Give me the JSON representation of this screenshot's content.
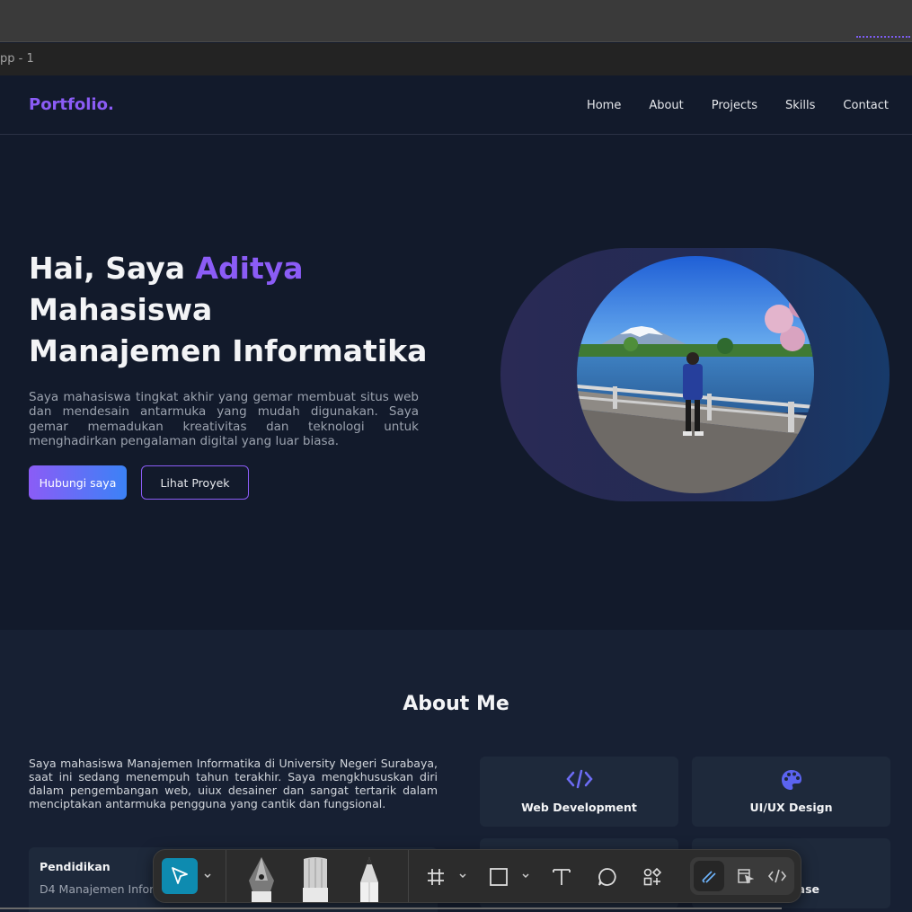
{
  "editor": {
    "frame_label": "pp - 1"
  },
  "nav": {
    "logo": "Portfolio.",
    "links": [
      "Home",
      "About",
      "Projects",
      "Skills",
      "Contact"
    ]
  },
  "hero": {
    "greeting": "Hai, Saya ",
    "name": "Aditya",
    "line2": "Mahasiswa",
    "line3": "Manajemen Informatika",
    "description": "Saya mahasiswa tingkat akhir yang gemar membuat situs web dan mendesain antarmuka yang mudah digunakan. Saya gemar memadukan kreativitas dan teknologi untuk menghadirkan pengalaman digital yang luar biasa.",
    "primary_button": "Hubungi saya",
    "secondary_button": "Lihat Proyek"
  },
  "about": {
    "title": "About Me",
    "description": "Saya mahasiswa Manajemen Informatika di University Negeri Surabaya, saat ini sedang menempuh tahun terakhir. Saya mengkhususkan diri dalam pengembangan web, uiux desainer dan sangat tertarik dalam menciptakan antarmuka pengguna yang cantik dan fungsional.",
    "cards": [
      {
        "label": "Web Development",
        "icon": "code-icon"
      },
      {
        "label": "UI/UX Design",
        "icon": "palette-icon"
      },
      {
        "label": "ase",
        "icon": "database-icon"
      }
    ],
    "education": {
      "title": "Pendidikan",
      "detail": "D4 Manajemen Infor"
    }
  },
  "toolbar": {
    "tools": [
      "move-icon",
      "pen-icon",
      "brush-icon",
      "pencil-icon",
      "frame-icon",
      "rectangle-icon",
      "text-icon",
      "comment-icon",
      "components-icon",
      "draw-mode-icon",
      "design-mode-icon",
      "dev-mode-icon"
    ]
  },
  "colors": {
    "accent": "#8b5cf6",
    "accent2": "#3b82f6",
    "background": "#121a2b",
    "card": "#1e293b",
    "tool_active": "#0e8bb0"
  }
}
